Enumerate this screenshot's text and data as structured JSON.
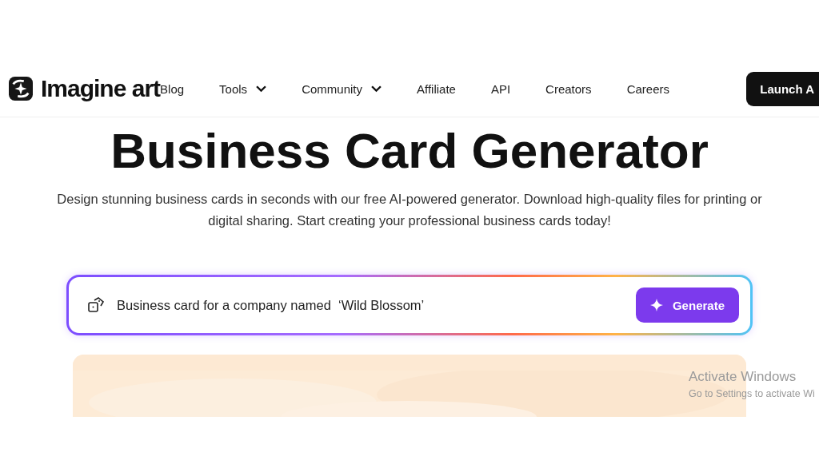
{
  "header": {
    "logo": "Imagine art",
    "nav": [
      {
        "label": "Blog",
        "has_dropdown": false
      },
      {
        "label": "Tools",
        "has_dropdown": true
      },
      {
        "label": "Community",
        "has_dropdown": true
      },
      {
        "label": "Affiliate",
        "has_dropdown": false
      },
      {
        "label": "API",
        "has_dropdown": false
      },
      {
        "label": "Creators",
        "has_dropdown": false
      },
      {
        "label": "Careers",
        "has_dropdown": false
      }
    ],
    "launch_button": "Launch A"
  },
  "hero": {
    "title": "Business Card Generator",
    "subtitle": "Design stunning business cards in seconds with our free AI-powered generator. Download high-quality files for printing or digital sharing. Start creating your professional business cards today!"
  },
  "prompt": {
    "value": "Business card for a company named  ‘Wild Blossom’",
    "generate_button": "Generate"
  },
  "os_notice": {
    "title": "Activate Windows",
    "text": "Go to Settings to activate Wi"
  }
}
